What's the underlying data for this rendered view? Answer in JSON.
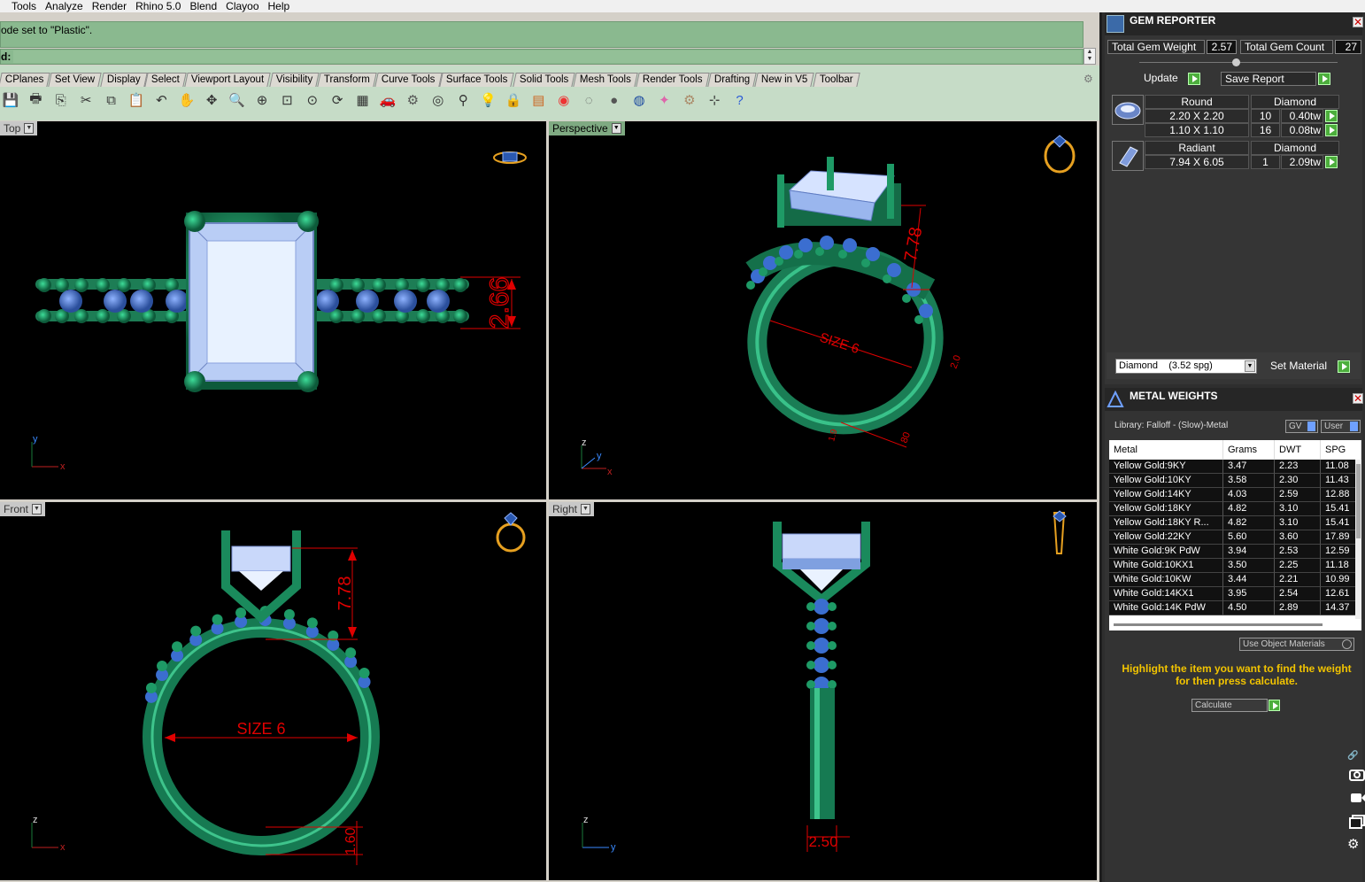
{
  "menu": [
    "Tools",
    "Analyze",
    "Render",
    "Rhino 5.0",
    "Blend",
    "Clayoo",
    "Help"
  ],
  "command": {
    "history_line": "ode set to \"Plastic\".",
    "prompt_label": "d:"
  },
  "toolbar_tabs": [
    "CPlanes",
    "Set View",
    "Display",
    "Select",
    "Viewport Layout",
    "Visibility",
    "Transform",
    "Curve Tools",
    "Surface Tools",
    "Solid Tools",
    "Mesh Tools",
    "Render Tools",
    "Drafting",
    "New in V5",
    "Toolbar"
  ],
  "toolbar_icons": [
    "save-icon",
    "print-icon",
    "export-icon",
    "cut-icon",
    "copy-icon",
    "paste-icon",
    "undo-icon",
    "pan-hand-icon",
    "move-view-icon",
    "zoom-icon",
    "zoom-window-icon",
    "zoom-extents-icon",
    "zoom-selected-icon",
    "rotate-view-icon",
    "four-viewports-icon",
    "car-icon",
    "properties-icon",
    "snap-icon",
    "osnap-icon",
    "light-icon",
    "lock-icon",
    "layer-icon",
    "color-wheel-icon",
    "wireframe-sphere-icon",
    "shaded-sphere-icon",
    "rendered-sphere-icon",
    "render-icon",
    "gear-options-icon",
    "grid-snap-icon",
    "help-icon"
  ],
  "viewports": {
    "top": {
      "label": "Top",
      "dim_width": "2.66",
      "axis_v": "y",
      "axis_h": "x"
    },
    "perspective": {
      "label": "Perspective",
      "dim_height": "7.78",
      "dim_size": "SIZE 6",
      "dim_small_a": "2.0",
      "dim_small_b": "1.9",
      "dim_small_c": "80",
      "axis_v": "z",
      "axis_m": "y",
      "axis_h": "x"
    },
    "front": {
      "label": "Front",
      "dim_height": "7.78",
      "dim_size": "SIZE 6",
      "dim_bottom": "1.60",
      "axis_v": "z",
      "axis_h": "x"
    },
    "right": {
      "label": "Right",
      "dim_width": "2.50",
      "axis_v": "z",
      "axis_h": "y"
    }
  },
  "gem_reporter": {
    "title": "GEM REPORTER",
    "total_weight_label": "Total Gem Weight",
    "total_weight": "2.57",
    "total_count_label": "Total Gem Count",
    "total_count": "27",
    "update_label": "Update",
    "save_report_label": "Save Report",
    "groups": [
      {
        "shape": "Round",
        "material": "Diamond",
        "rows": [
          {
            "size": "2.20 X 2.20",
            "count": "10",
            "weight": "0.40tw"
          },
          {
            "size": "1.10 X 1.10",
            "count": "16",
            "weight": "0.08tw"
          }
        ]
      },
      {
        "shape": "Radiant",
        "material": "Diamond",
        "rows": [
          {
            "size": "7.94 X 6.05",
            "count": "1",
            "weight": "2.09tw"
          }
        ]
      }
    ],
    "material_select": "Diamond    (3.52 spg)",
    "set_material_label": "Set Material"
  },
  "metal_weights": {
    "title": "METAL WEIGHTS",
    "library": "Library: Falloff - (Slow)-Metal",
    "gv_label": "GV",
    "user_label": "User",
    "columns": [
      "Metal",
      "Grams",
      "DWT",
      "SPG"
    ],
    "rows": [
      [
        "Yellow Gold:9KY",
        "3.47",
        "2.23",
        "11.08"
      ],
      [
        "Yellow Gold:10KY",
        "3.58",
        "2.30",
        "11.43"
      ],
      [
        "Yellow Gold:14KY",
        "4.03",
        "2.59",
        "12.88"
      ],
      [
        "Yellow Gold:18KY",
        "4.82",
        "3.10",
        "15.41"
      ],
      [
        "Yellow Gold:18KY R...",
        "4.82",
        "3.10",
        "15.41"
      ],
      [
        "Yellow Gold:22KY",
        "5.60",
        "3.60",
        "17.89"
      ],
      [
        "White Gold:9K PdW",
        "3.94",
        "2.53",
        "12.59"
      ],
      [
        "White Gold:10KX1",
        "3.50",
        "2.25",
        "11.18"
      ],
      [
        "White Gold:10KW",
        "3.44",
        "2.21",
        "10.99"
      ],
      [
        "White Gold:14KX1",
        "3.95",
        "2.54",
        "12.61"
      ],
      [
        "White Gold:14K PdW",
        "4.50",
        "2.89",
        "14.37"
      ]
    ],
    "use_object_materials": "Use Object Materials",
    "hint": "Highlight the item you want to find the weight for then press calculate.",
    "calculate_label": "Calculate"
  },
  "colors": {
    "command_green": "#8ab98f",
    "metal_green": "#1e8c5f",
    "gem_blue": "#a9c4f2",
    "dimension_red": "#e00000",
    "hint_yellow": "#f2c400"
  }
}
